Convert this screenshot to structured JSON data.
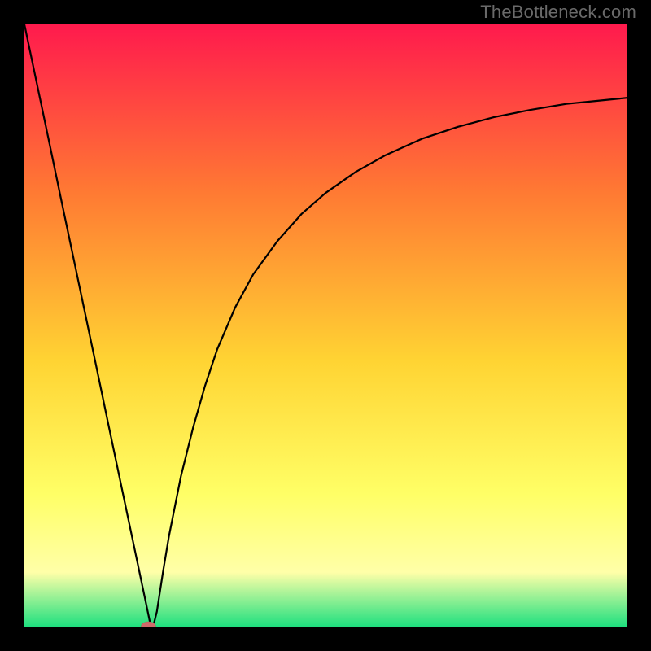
{
  "watermark": "TheBottleneck.com",
  "chart_data": {
    "type": "line",
    "title": "",
    "xlabel": "",
    "ylabel": "",
    "xlim": [
      0,
      100
    ],
    "ylim": [
      0,
      100
    ],
    "grid": false,
    "legend": false,
    "background_gradient": {
      "top_color": "#ff1a4d",
      "upper_mid_color": "#ff7a33",
      "mid_color": "#ffd433",
      "lower_mid_color": "#ffff66",
      "band_color": "#ffffa8",
      "bottom_color": "#1fe07f"
    },
    "series": [
      {
        "name": "bottleneck-curve",
        "x": [
          0,
          2,
          4,
          6,
          8,
          10,
          12,
          14,
          16,
          18,
          20,
          20.5,
          21,
          21.5,
          22,
          23,
          24,
          26,
          28,
          30,
          32,
          35,
          38,
          42,
          46,
          50,
          55,
          60,
          66,
          72,
          78,
          84,
          90,
          95,
          100
        ],
        "y": [
          100,
          90.5,
          81,
          71.4,
          61.9,
          52.4,
          42.9,
          33.3,
          23.8,
          14.3,
          4.8,
          2.4,
          0.0,
          0.5,
          2.5,
          9.0,
          15.0,
          25.0,
          33.0,
          40.0,
          46.0,
          53.0,
          58.5,
          64.0,
          68.5,
          72.0,
          75.5,
          78.3,
          81.0,
          83.0,
          84.6,
          85.8,
          86.8,
          87.3,
          87.8
        ]
      }
    ],
    "marker": {
      "name": "optimal-point",
      "x": 20.6,
      "y": 0.0
    }
  }
}
